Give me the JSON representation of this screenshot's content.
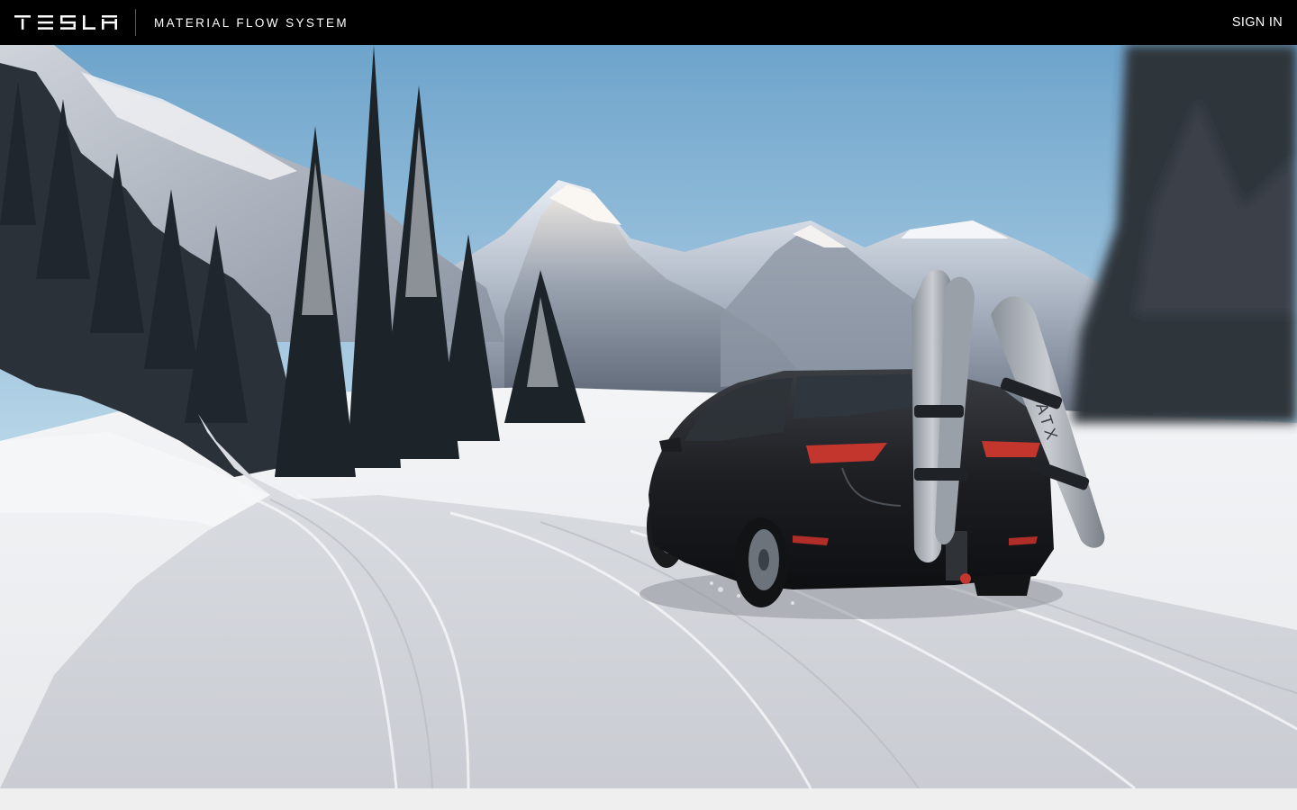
{
  "header": {
    "brand_logo_text": "TESLA",
    "app_title": "MATERIAL FLOW SYSTEM",
    "sign_in_label": "SIGN IN"
  },
  "hero": {
    "subject": "hero-photo-model-x-winter-road",
    "colors": {
      "sky_top": "#6fa6cc",
      "sky_bottom": "#d6e8f2",
      "snow": "#eef0f3",
      "car": "#1b1d20",
      "taillight": "#c23a32"
    }
  },
  "colors": {
    "topbar": "#000000",
    "topbar_text": "#ffffff",
    "page_bg": "#f0f0f0"
  }
}
